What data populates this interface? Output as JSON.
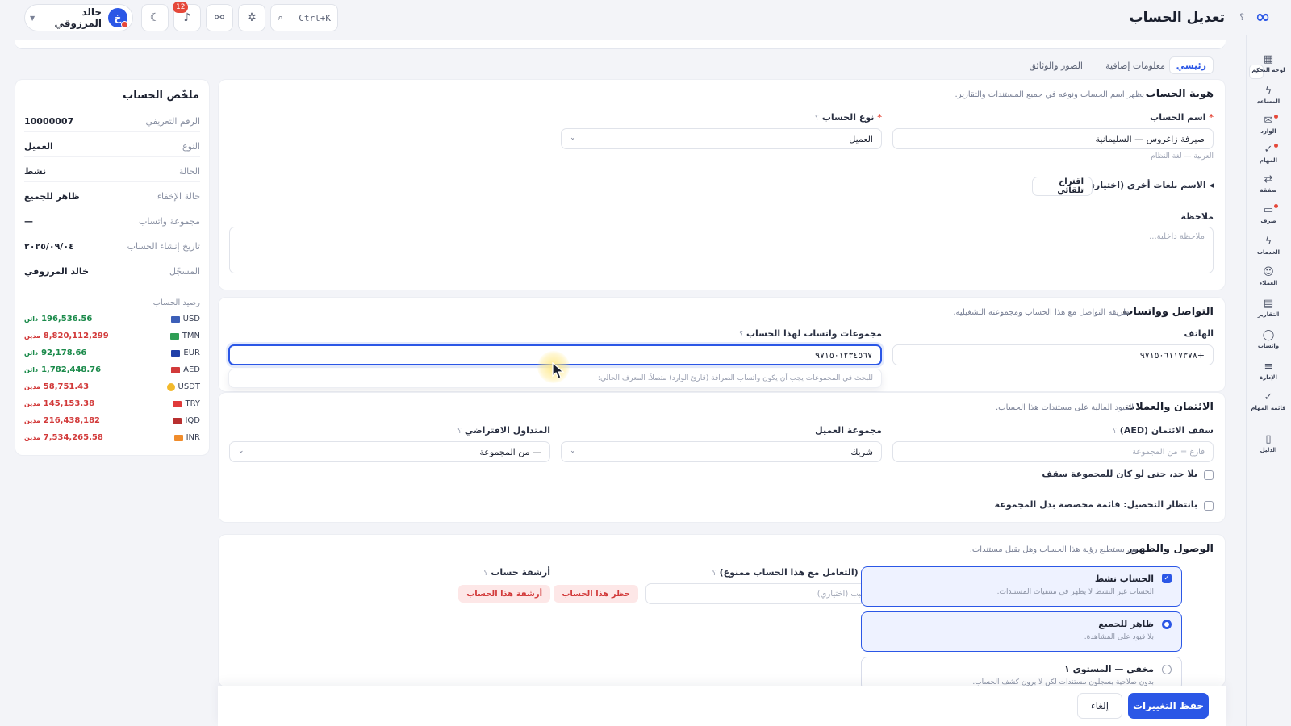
{
  "header": {
    "title": "تعديل الحساب",
    "help": "؟",
    "search_shortcut": "Ctrl+K",
    "notifications_count": "12",
    "user": {
      "initial": "خ",
      "name": "خالد المرزوقي"
    }
  },
  "rail": {
    "items": [
      {
        "label": "لوحة التحكم",
        "icon": "▦"
      },
      {
        "label": "المساعد",
        "icon": "ϟ"
      },
      {
        "label": "الوارد",
        "icon": "✉"
      },
      {
        "label": "المهام",
        "icon": "✓"
      },
      {
        "label": "صفقة",
        "icon": "⇄"
      },
      {
        "label": "صرف",
        "icon": "▭"
      },
      {
        "label": "الخدمات",
        "icon": "ϟ"
      },
      {
        "label": "العملاء",
        "icon": "☺"
      },
      {
        "label": "التقارير",
        "icon": "▤"
      },
      {
        "label": "واتساب",
        "icon": "◯"
      },
      {
        "label": "الإدارة",
        "icon": "≡"
      },
      {
        "label": "قائمة المهام",
        "icon": "✓"
      },
      {
        "label": "الدليل",
        "icon": "▯"
      }
    ]
  },
  "tabs": [
    {
      "label": "رئيسي"
    },
    {
      "label": "معلومات إضافية"
    },
    {
      "label": "الصور والوثائق"
    }
  ],
  "identity": {
    "title": "هوية الحساب",
    "subtitle": "يظهر اسم الحساب ونوعه في جميع المستندات والتقارير.",
    "name_label": "اسم الحساب",
    "name_value": "صيرفة زاغروس — السليمانية",
    "name_hint": "العربية — لغة النظام",
    "type_label": "نوع الحساب",
    "type_value": "العميل",
    "other_lang_label": "الاسم بلغات أخرى (اختياري)",
    "auto_suggest": "اقتراح تلقائي",
    "note_label": "ملاحظة",
    "note_placeholder": "ملاحظة داخلية..."
  },
  "contact": {
    "title": "التواصل وواتساب",
    "subtitle": "طريقة التواصل مع هذا الحساب ومجموعته التشغيلية.",
    "phone_label": "الهاتف",
    "phone_value": "+٩٧١٥٠٦١١٧٣٧٨",
    "whatsapp_label": "مجموعات واتساب لهذا الحساب",
    "whatsapp_value": "٩٧١٥٠١٢٣٤٥٦٧",
    "whatsapp_hint": "للبحث في المجموعات يجب أن يكون واتساب الصرافة (قارئ الوارد) متصلاً. المعرف الحالي:"
  },
  "credit": {
    "title": "الائتمان والعملات",
    "subtitle": "القيود المالية على مستندات هذا الحساب.",
    "limit_label": "سقف الائتمان (AED)",
    "limit_placeholder": "فارغ = من المجموعة",
    "group_label": "مجموعة العميل",
    "group_value": "شريك",
    "currency_label": "المتداول الافتراضي",
    "currency_value": "— من المجموعة",
    "no_limit_label": "بلا حد، حتى لو كان للمجموعة سقف",
    "pending_label": "بانتظار التحصيل: قائمة مخصصة بدل المجموعة"
  },
  "access": {
    "title": "الوصول والظهور",
    "subtitle": "من يستطيع رؤية هذا الحساب وهل يقبل مستندات.",
    "active_title": "الحساب نشط",
    "active_desc": "الحساب غير النشط لا يظهر في منتقيات المستندات.",
    "visible_title": "ظاهر للجميع",
    "visible_desc": "بلا قيود على المشاهدة.",
    "hidden_title": "مخفي — المستوى ١",
    "hidden_desc": "بدون صلاحية يسجلون مستندات لكن لا يرون كشف الحساب.",
    "block_label": "حظر (التعامل مع هذا الحساب ممنوع)",
    "block_placeholder": "السبب (اختياري)",
    "block_button": "حظر هذا الحساب",
    "archive_label": "أرشفة حساب",
    "archive_button": "أرشفة هذا الحساب"
  },
  "summary": {
    "title": "ملخّص الحساب",
    "rows": [
      {
        "key": "الرقم التعريفي",
        "value": "10000007"
      },
      {
        "key": "النوع",
        "value": "العميل"
      },
      {
        "key": "الحالة",
        "value": "نشط"
      },
      {
        "key": "حالة الإخفاء",
        "value": "ظاهر للجميع"
      },
      {
        "key": "مجموعة واتساب",
        "value": "—"
      },
      {
        "key": "تاريخ إنشاء الحساب",
        "value": "٢٠٢٥/٠٩/٠٤"
      },
      {
        "key": "المسجّل",
        "value": "خالد المرزوقي"
      }
    ],
    "balance_title": "رصيد الحساب",
    "balances": [
      {
        "currency": "USD",
        "amount": "196,536.56",
        "tag": "دائن",
        "kind": "credit",
        "flag": "#3c5fb8"
      },
      {
        "currency": "TMN",
        "amount": "8,820,112,299",
        "tag": "مدين",
        "kind": "debit",
        "flag": "#2f9e55"
      },
      {
        "currency": "EUR",
        "amount": "92,178.66",
        "tag": "دائن",
        "kind": "credit",
        "flag": "#1f3fa8"
      },
      {
        "currency": "AED",
        "amount": "1,782,448.76",
        "tag": "دائن",
        "kind": "credit",
        "flag": "#d23a3a"
      },
      {
        "currency": "USDT",
        "amount": "58,751.43",
        "tag": "مدين",
        "kind": "debit",
        "flag": "#f2b92b"
      },
      {
        "currency": "TRY",
        "amount": "145,153.38",
        "tag": "مدين",
        "kind": "debit",
        "flag": "#e03a3a"
      },
      {
        "currency": "IQD",
        "amount": "216,438,182",
        "tag": "مدين",
        "kind": "debit",
        "flag": "#b83030"
      },
      {
        "currency": "INR",
        "amount": "7,534,265.58",
        "tag": "مدين",
        "kind": "debit",
        "flag": "#f08c2b"
      }
    ]
  },
  "footer": {
    "save": "حفظ التغييرات",
    "cancel": "إلغاء"
  }
}
